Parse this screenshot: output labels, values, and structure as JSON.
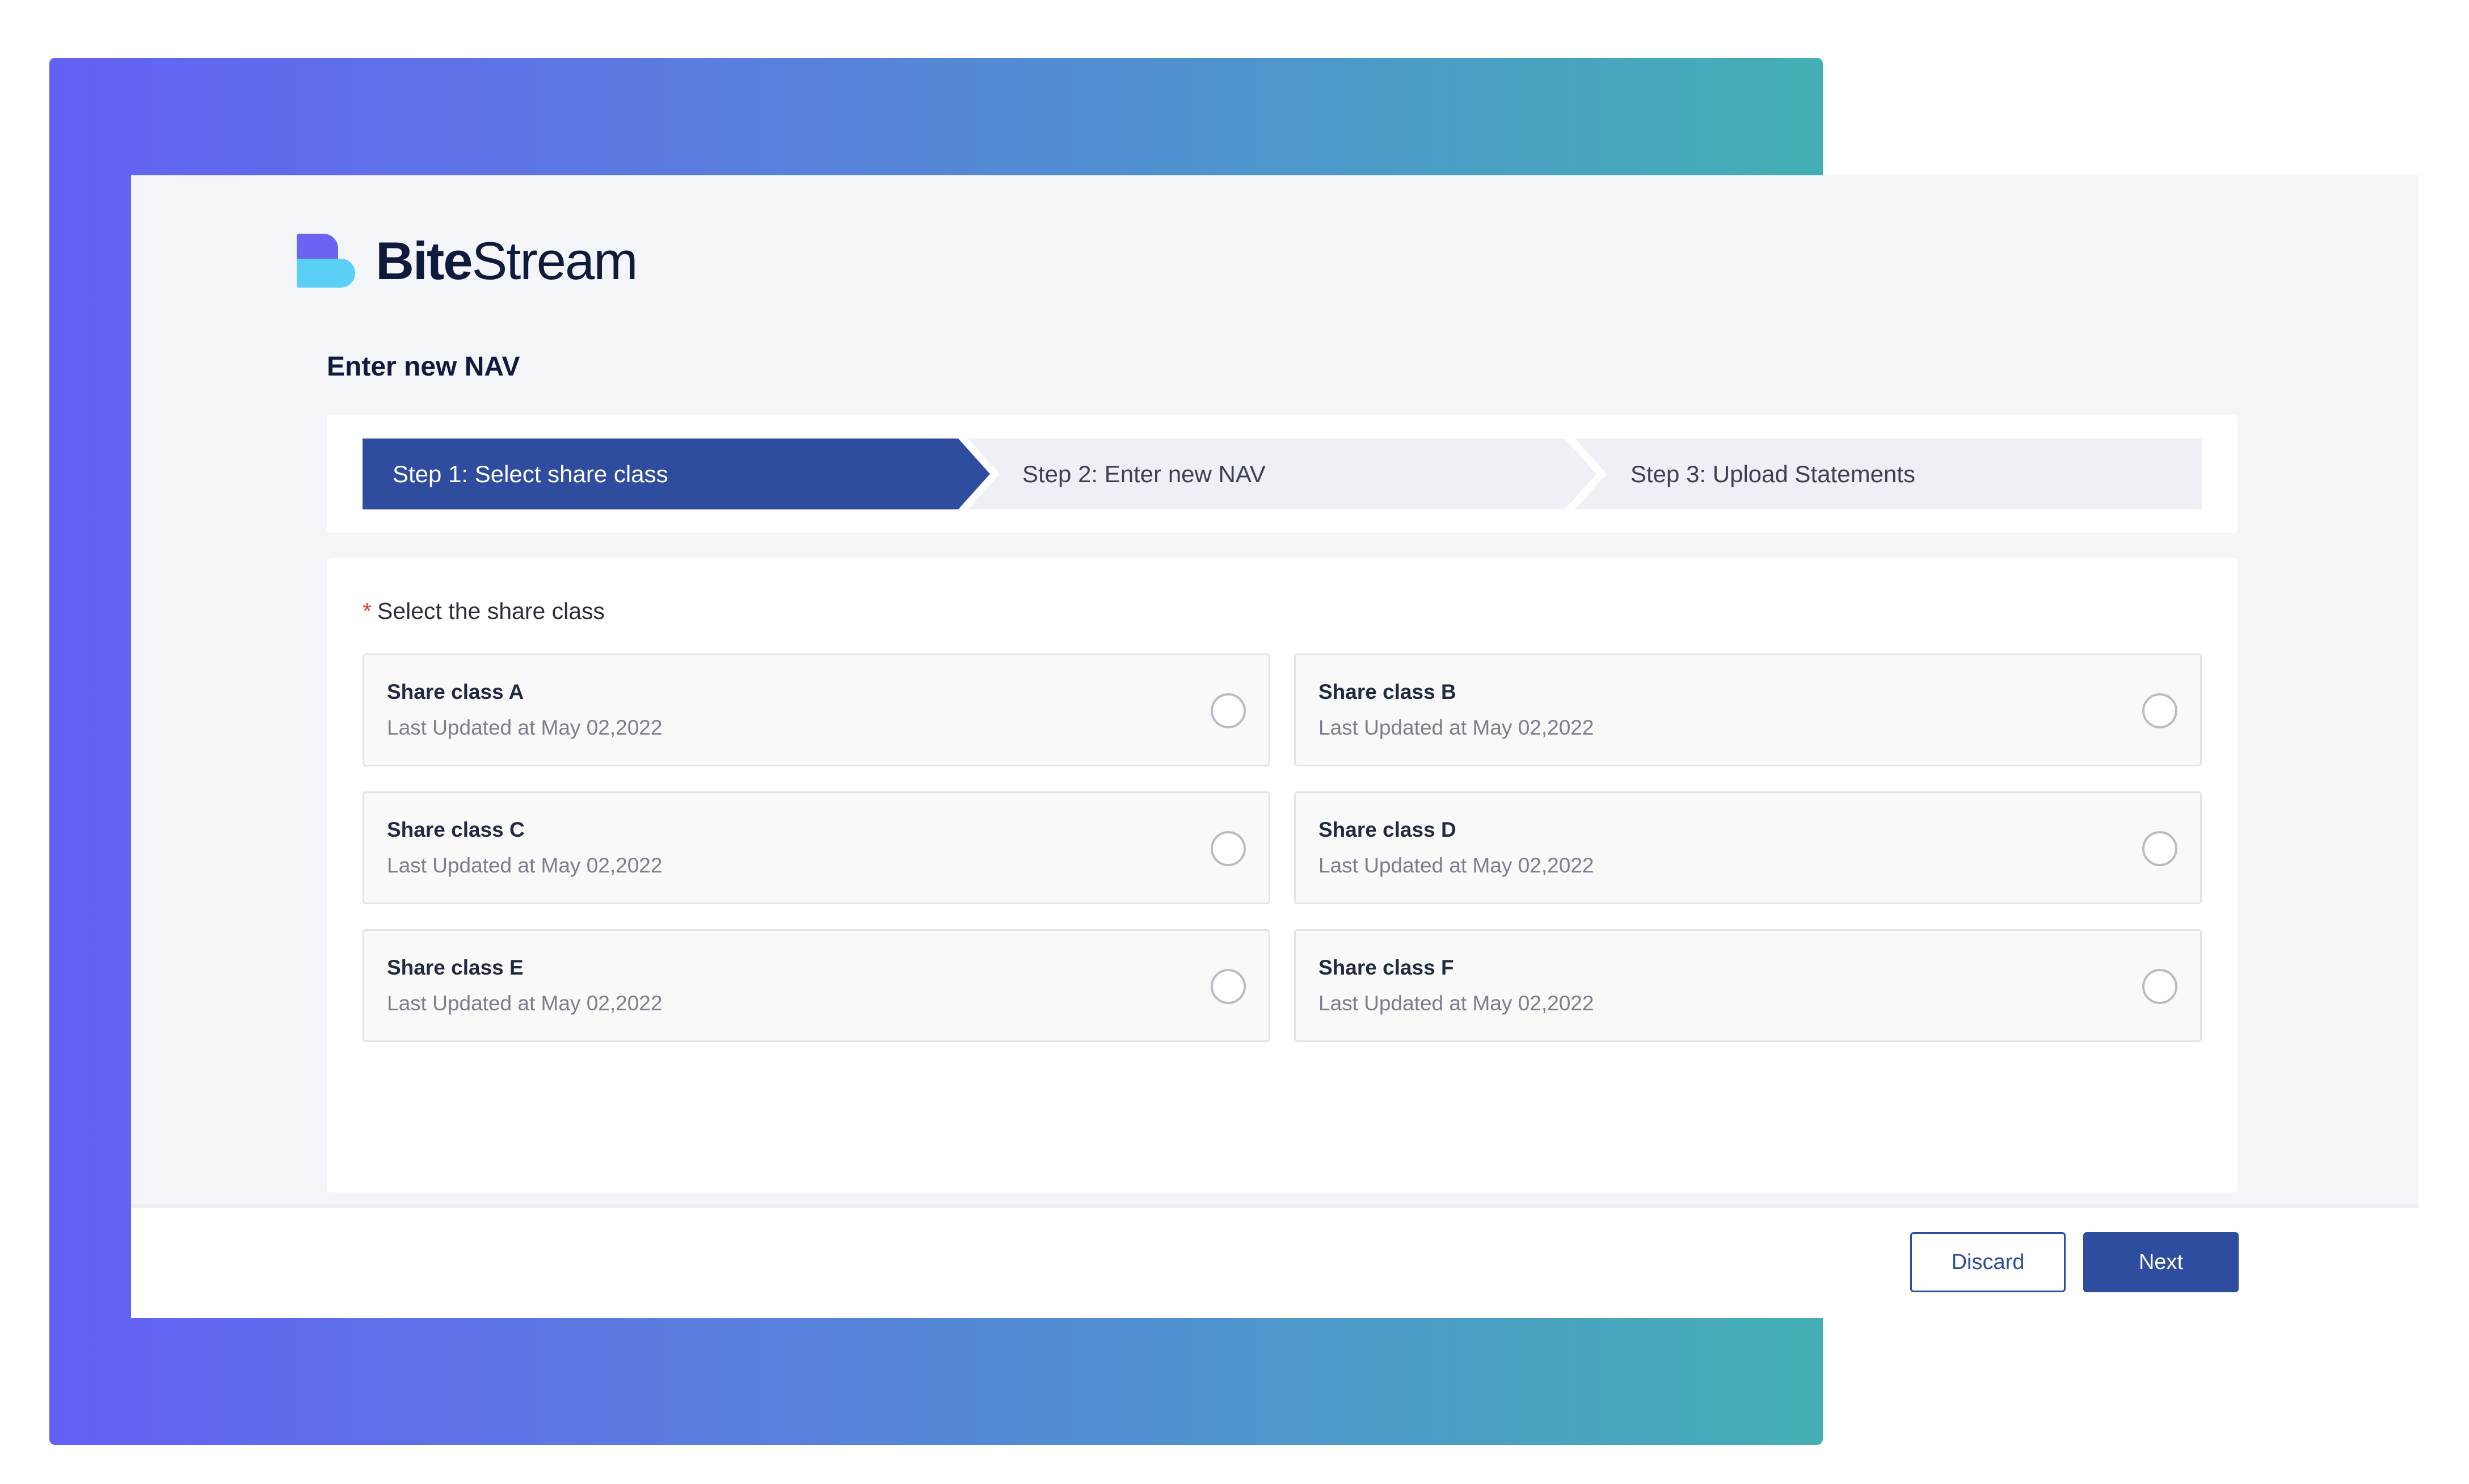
{
  "brand": {
    "name_bold": "Bite",
    "name_regular": "Stream"
  },
  "page": {
    "title": "Enter new NAV"
  },
  "stepper": {
    "steps": [
      {
        "label": "Step 1: Select share class",
        "active": true
      },
      {
        "label": "Step 2: Enter new NAV",
        "active": false
      },
      {
        "label": "Step 3: Upload Statements",
        "active": false
      }
    ]
  },
  "form": {
    "required_marker": "*",
    "label": "Select the share class",
    "options": [
      {
        "name": "Share class A",
        "meta": "Last Updated at May 02,2022",
        "selected": false
      },
      {
        "name": "Share class B",
        "meta": "Last Updated at May 02,2022",
        "selected": false
      },
      {
        "name": "Share class C",
        "meta": "Last Updated at May 02,2022",
        "selected": false
      },
      {
        "name": "Share class D",
        "meta": "Last Updated at May 02,2022",
        "selected": false
      },
      {
        "name": "Share class E",
        "meta": "Last Updated at May 02,2022",
        "selected": false
      },
      {
        "name": "Share class F",
        "meta": "Last Updated at May 02,2022",
        "selected": false
      }
    ]
  },
  "footer": {
    "discard_label": "Discard",
    "next_label": "Next"
  },
  "colors": {
    "primary": "#2e4d9e",
    "gradient_start": "#6361f4",
    "gradient_end": "#44afb4",
    "logo_top": "#6c63f2",
    "logo_bottom": "#5bd0f7",
    "required": "#e23b3b"
  }
}
